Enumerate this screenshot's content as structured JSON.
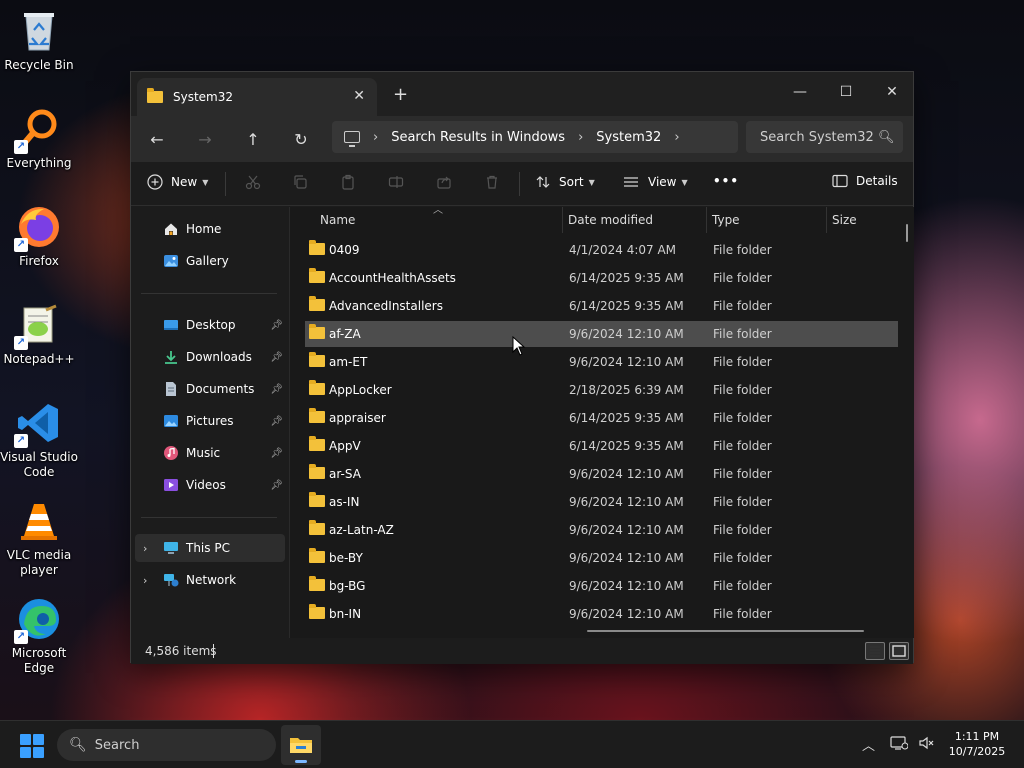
{
  "desktop": {
    "icons": [
      {
        "label": "Recycle Bin",
        "icon": "recycle-bin-icon"
      },
      {
        "label": "Everything",
        "icon": "everything-search-icon"
      },
      {
        "label": "Firefox",
        "icon": "firefox-icon"
      },
      {
        "label": "Notepad++",
        "icon": "notepadpp-icon"
      },
      {
        "label": "Visual Studio Code",
        "icon": "vscode-icon"
      },
      {
        "label": "VLC media player",
        "icon": "vlc-icon"
      },
      {
        "label": "Microsoft Edge",
        "icon": "edge-icon"
      }
    ]
  },
  "window": {
    "tab_title": "System32",
    "tab_close": "✕",
    "new_tab": "+",
    "controls": {
      "minimize": "—",
      "maximize": "☐",
      "close": "✕"
    }
  },
  "nav": {
    "back": "←",
    "forward": "→",
    "up": "↑",
    "refresh": "↻",
    "breadcrumb": [
      "Search Results in Windows",
      "System32"
    ],
    "search_placeholder": "Search System32"
  },
  "toolbar": {
    "new_label": "New",
    "sort_label": "Sort",
    "view_label": "View",
    "more_label": "•••",
    "details_label": "Details"
  },
  "sidebar": {
    "quick": [
      {
        "label": "Home",
        "icon": "home-icon"
      },
      {
        "label": "Gallery",
        "icon": "gallery-icon"
      }
    ],
    "pinned": [
      {
        "label": "Desktop",
        "icon": "desktop-icon"
      },
      {
        "label": "Downloads",
        "icon": "downloads-icon"
      },
      {
        "label": "Documents",
        "icon": "documents-icon"
      },
      {
        "label": "Pictures",
        "icon": "pictures-icon"
      },
      {
        "label": "Music",
        "icon": "music-icon"
      },
      {
        "label": "Videos",
        "icon": "videos-icon"
      }
    ],
    "locations": [
      {
        "label": "This PC",
        "icon": "this-pc-icon",
        "selected": true
      },
      {
        "label": "Network",
        "icon": "network-icon",
        "selected": false
      }
    ]
  },
  "filelist": {
    "columns": {
      "name": "Name",
      "date": "Date modified",
      "type": "Type",
      "size": "Size"
    },
    "rows": [
      {
        "name": "0409",
        "date": "4/1/2024 4:07 AM",
        "type": "File folder"
      },
      {
        "name": "AccountHealthAssets",
        "date": "6/14/2025 9:35 AM",
        "type": "File folder"
      },
      {
        "name": "AdvancedInstallers",
        "date": "6/14/2025 9:35 AM",
        "type": "File folder"
      },
      {
        "name": "af-ZA",
        "date": "9/6/2024 12:10 AM",
        "type": "File folder",
        "hover": true
      },
      {
        "name": "am-ET",
        "date": "9/6/2024 12:10 AM",
        "type": "File folder"
      },
      {
        "name": "AppLocker",
        "date": "2/18/2025 6:39 AM",
        "type": "File folder"
      },
      {
        "name": "appraiser",
        "date": "6/14/2025 9:35 AM",
        "type": "File folder"
      },
      {
        "name": "AppV",
        "date": "6/14/2025 9:35 AM",
        "type": "File folder"
      },
      {
        "name": "ar-SA",
        "date": "9/6/2024 12:10 AM",
        "type": "File folder"
      },
      {
        "name": "as-IN",
        "date": "9/6/2024 12:10 AM",
        "type": "File folder"
      },
      {
        "name": "az-Latn-AZ",
        "date": "9/6/2024 12:10 AM",
        "type": "File folder"
      },
      {
        "name": "be-BY",
        "date": "9/6/2024 12:10 AM",
        "type": "File folder"
      },
      {
        "name": "bg-BG",
        "date": "9/6/2024 12:10 AM",
        "type": "File folder"
      },
      {
        "name": "bn-IN",
        "date": "9/6/2024 12:10 AM",
        "type": "File folder"
      }
    ]
  },
  "status": {
    "item_count": "4,586 items"
  },
  "taskbar": {
    "search_placeholder": "Search",
    "time": "1:11 PM",
    "date": "10/7/2025"
  },
  "colors": {
    "accent": "#3aa0ff",
    "folder": "#f3c13a",
    "window_bg": "#1c1c1c",
    "hover_row": "#4d4d4d"
  }
}
